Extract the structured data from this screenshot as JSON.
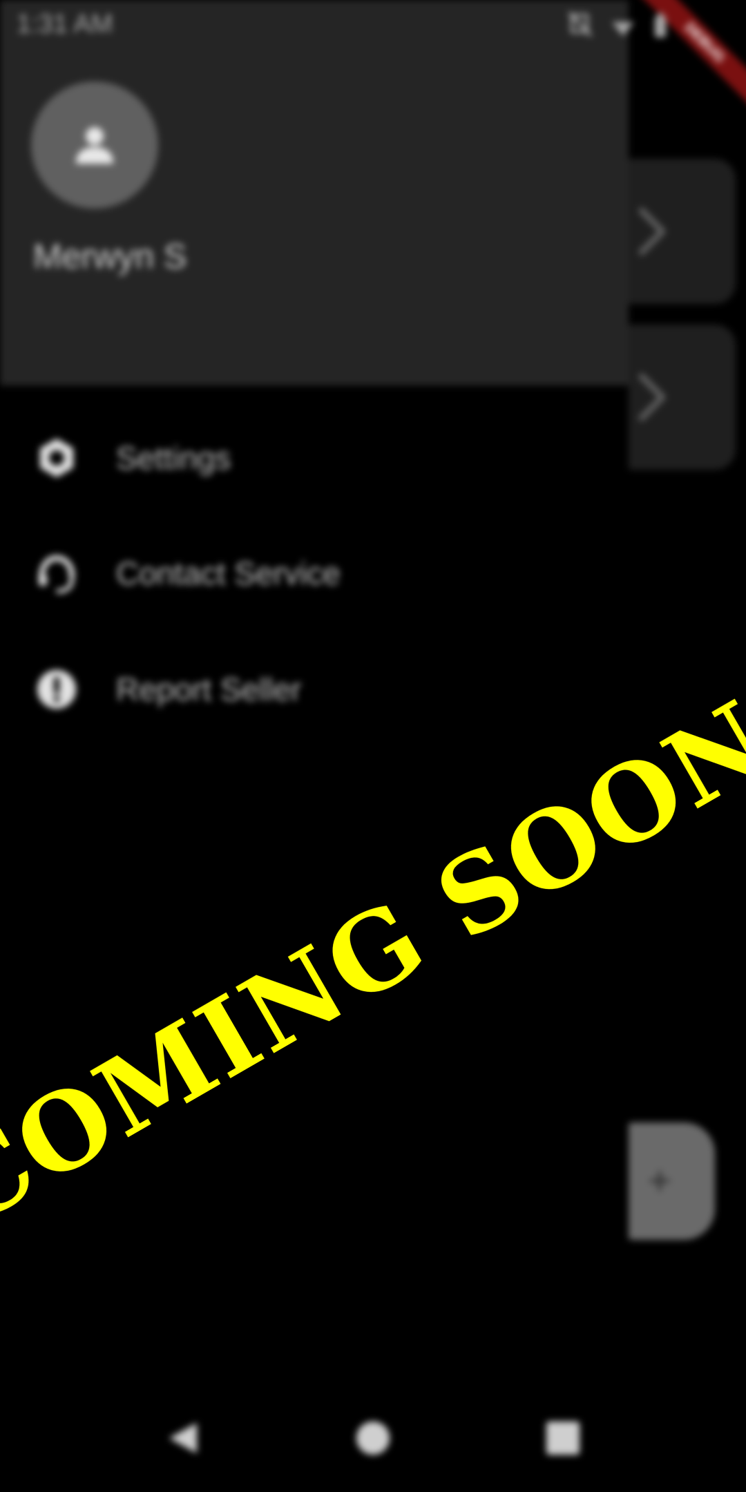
{
  "status_bar": {
    "time": "1:31 AM",
    "icons": [
      "notification-off-icon",
      "wifi-icon",
      "battery-icon"
    ]
  },
  "debug_banner": {
    "label": "DEBUG"
  },
  "drawer": {
    "header": {
      "avatar_icon": "person-icon",
      "user_name": "Merwyn S"
    },
    "menu": [
      {
        "icon": "gear-icon",
        "label": "Settings"
      },
      {
        "icon": "headset-icon",
        "label": "Contact Service"
      },
      {
        "icon": "alert-circle-icon",
        "label": "Report Seller"
      }
    ]
  },
  "background_page": {
    "cards": [
      {
        "icon": "chevron-right-icon"
      },
      {
        "icon": "chevron-right-icon"
      }
    ],
    "fab": {
      "icon": "plus-icon",
      "label": "+"
    }
  },
  "overlay": {
    "text": "COMING SOON",
    "color": "#ffff00"
  },
  "nav_bar": {
    "buttons": [
      "back-icon",
      "home-icon",
      "recents-icon"
    ]
  },
  "colors": {
    "drawer_header_bg": "#252525",
    "background": "#000000",
    "avatar_bg": "#606060",
    "text_primary": "#cfcfcf"
  }
}
